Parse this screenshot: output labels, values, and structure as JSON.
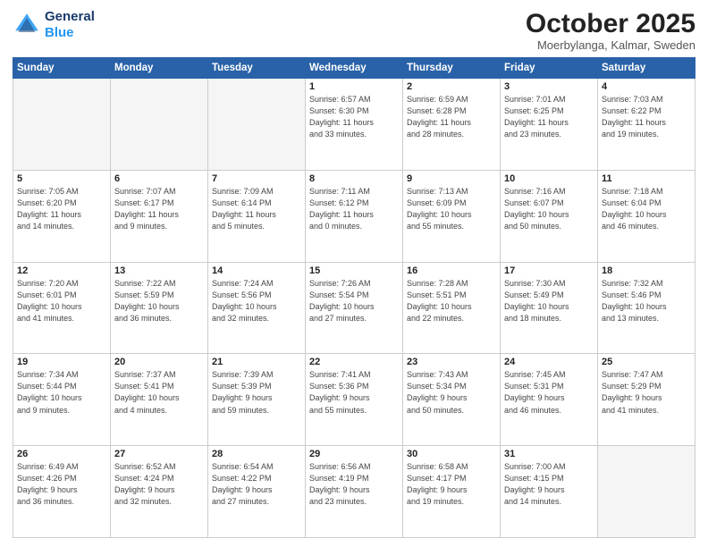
{
  "header": {
    "logo_line1": "General",
    "logo_line2": "Blue",
    "month": "October 2025",
    "location": "Moerbylanga, Kalmar, Sweden"
  },
  "weekdays": [
    "Sunday",
    "Monday",
    "Tuesday",
    "Wednesday",
    "Thursday",
    "Friday",
    "Saturday"
  ],
  "weeks": [
    [
      {
        "day": "",
        "info": ""
      },
      {
        "day": "",
        "info": ""
      },
      {
        "day": "",
        "info": ""
      },
      {
        "day": "1",
        "info": "Sunrise: 6:57 AM\nSunset: 6:30 PM\nDaylight: 11 hours\nand 33 minutes."
      },
      {
        "day": "2",
        "info": "Sunrise: 6:59 AM\nSunset: 6:28 PM\nDaylight: 11 hours\nand 28 minutes."
      },
      {
        "day": "3",
        "info": "Sunrise: 7:01 AM\nSunset: 6:25 PM\nDaylight: 11 hours\nand 23 minutes."
      },
      {
        "day": "4",
        "info": "Sunrise: 7:03 AM\nSunset: 6:22 PM\nDaylight: 11 hours\nand 19 minutes."
      }
    ],
    [
      {
        "day": "5",
        "info": "Sunrise: 7:05 AM\nSunset: 6:20 PM\nDaylight: 11 hours\nand 14 minutes."
      },
      {
        "day": "6",
        "info": "Sunrise: 7:07 AM\nSunset: 6:17 PM\nDaylight: 11 hours\nand 9 minutes."
      },
      {
        "day": "7",
        "info": "Sunrise: 7:09 AM\nSunset: 6:14 PM\nDaylight: 11 hours\nand 5 minutes."
      },
      {
        "day": "8",
        "info": "Sunrise: 7:11 AM\nSunset: 6:12 PM\nDaylight: 11 hours\nand 0 minutes."
      },
      {
        "day": "9",
        "info": "Sunrise: 7:13 AM\nSunset: 6:09 PM\nDaylight: 10 hours\nand 55 minutes."
      },
      {
        "day": "10",
        "info": "Sunrise: 7:16 AM\nSunset: 6:07 PM\nDaylight: 10 hours\nand 50 minutes."
      },
      {
        "day": "11",
        "info": "Sunrise: 7:18 AM\nSunset: 6:04 PM\nDaylight: 10 hours\nand 46 minutes."
      }
    ],
    [
      {
        "day": "12",
        "info": "Sunrise: 7:20 AM\nSunset: 6:01 PM\nDaylight: 10 hours\nand 41 minutes."
      },
      {
        "day": "13",
        "info": "Sunrise: 7:22 AM\nSunset: 5:59 PM\nDaylight: 10 hours\nand 36 minutes."
      },
      {
        "day": "14",
        "info": "Sunrise: 7:24 AM\nSunset: 5:56 PM\nDaylight: 10 hours\nand 32 minutes."
      },
      {
        "day": "15",
        "info": "Sunrise: 7:26 AM\nSunset: 5:54 PM\nDaylight: 10 hours\nand 27 minutes."
      },
      {
        "day": "16",
        "info": "Sunrise: 7:28 AM\nSunset: 5:51 PM\nDaylight: 10 hours\nand 22 minutes."
      },
      {
        "day": "17",
        "info": "Sunrise: 7:30 AM\nSunset: 5:49 PM\nDaylight: 10 hours\nand 18 minutes."
      },
      {
        "day": "18",
        "info": "Sunrise: 7:32 AM\nSunset: 5:46 PM\nDaylight: 10 hours\nand 13 minutes."
      }
    ],
    [
      {
        "day": "19",
        "info": "Sunrise: 7:34 AM\nSunset: 5:44 PM\nDaylight: 10 hours\nand 9 minutes."
      },
      {
        "day": "20",
        "info": "Sunrise: 7:37 AM\nSunset: 5:41 PM\nDaylight: 10 hours\nand 4 minutes."
      },
      {
        "day": "21",
        "info": "Sunrise: 7:39 AM\nSunset: 5:39 PM\nDaylight: 9 hours\nand 59 minutes."
      },
      {
        "day": "22",
        "info": "Sunrise: 7:41 AM\nSunset: 5:36 PM\nDaylight: 9 hours\nand 55 minutes."
      },
      {
        "day": "23",
        "info": "Sunrise: 7:43 AM\nSunset: 5:34 PM\nDaylight: 9 hours\nand 50 minutes."
      },
      {
        "day": "24",
        "info": "Sunrise: 7:45 AM\nSunset: 5:31 PM\nDaylight: 9 hours\nand 46 minutes."
      },
      {
        "day": "25",
        "info": "Sunrise: 7:47 AM\nSunset: 5:29 PM\nDaylight: 9 hours\nand 41 minutes."
      }
    ],
    [
      {
        "day": "26",
        "info": "Sunrise: 6:49 AM\nSunset: 4:26 PM\nDaylight: 9 hours\nand 36 minutes."
      },
      {
        "day": "27",
        "info": "Sunrise: 6:52 AM\nSunset: 4:24 PM\nDaylight: 9 hours\nand 32 minutes."
      },
      {
        "day": "28",
        "info": "Sunrise: 6:54 AM\nSunset: 4:22 PM\nDaylight: 9 hours\nand 27 minutes."
      },
      {
        "day": "29",
        "info": "Sunrise: 6:56 AM\nSunset: 4:19 PM\nDaylight: 9 hours\nand 23 minutes."
      },
      {
        "day": "30",
        "info": "Sunrise: 6:58 AM\nSunset: 4:17 PM\nDaylight: 9 hours\nand 19 minutes."
      },
      {
        "day": "31",
        "info": "Sunrise: 7:00 AM\nSunset: 4:15 PM\nDaylight: 9 hours\nand 14 minutes."
      },
      {
        "day": "",
        "info": ""
      }
    ]
  ]
}
